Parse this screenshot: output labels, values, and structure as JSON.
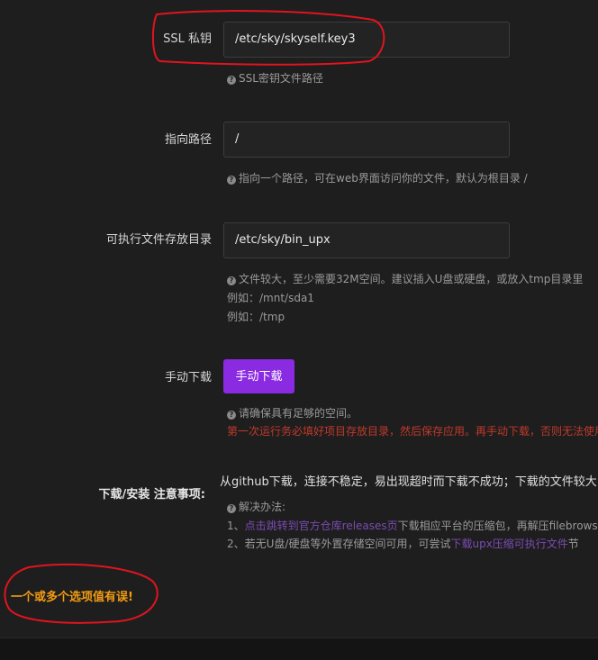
{
  "ssl_key": {
    "label": "SSL 私钥",
    "value": "/etc/sky/skyself.key3",
    "hint": "SSL密钥文件路径"
  },
  "path": {
    "label": "指向路径",
    "value": "/",
    "hint": "指向一个路径，可在web界面访问你的文件，默认为根目录 /"
  },
  "exec_dir": {
    "label": "可执行文件存放目录",
    "value": "/etc/sky/bin_upx",
    "hint": "文件较大，至少需要32M空间。建议插入U盘或硬盘，或放入tmp目录里",
    "example1": "例如：/mnt/sda1",
    "example2": "例如：/tmp"
  },
  "manual_download": {
    "label": "手动下载",
    "button": "手动下载",
    "hint": "请确保具有足够的空间。",
    "warning": "第一次运行务必填好项目存放目录，然后保存应用。再手动下载，否则无法使用"
  },
  "notes": {
    "label": "下载/安装 注意事项:",
    "main": "从github下载，连接不稳定，易出现超时而下载不成功；下载的文件较大",
    "solution_title": "解决办法:",
    "item1_prefix": "1、",
    "item1_link": "点击跳转到官方仓库releases页",
    "item1_text": "下载相应平台的压缩包，再解压filebrowser",
    "item2_prefix": "2、若无U盘/硬盘等外置存储空间可用，可尝试",
    "item2_link": "下载upx压缩可执行文件",
    "item2_text": "节"
  },
  "error_message": "一个或多个选项值有误!",
  "colors": {
    "accent_button": "#8a2be2",
    "error_text": "#f39c12",
    "warning_text": "#c0392b",
    "annotation_circle": "#e0141e"
  }
}
